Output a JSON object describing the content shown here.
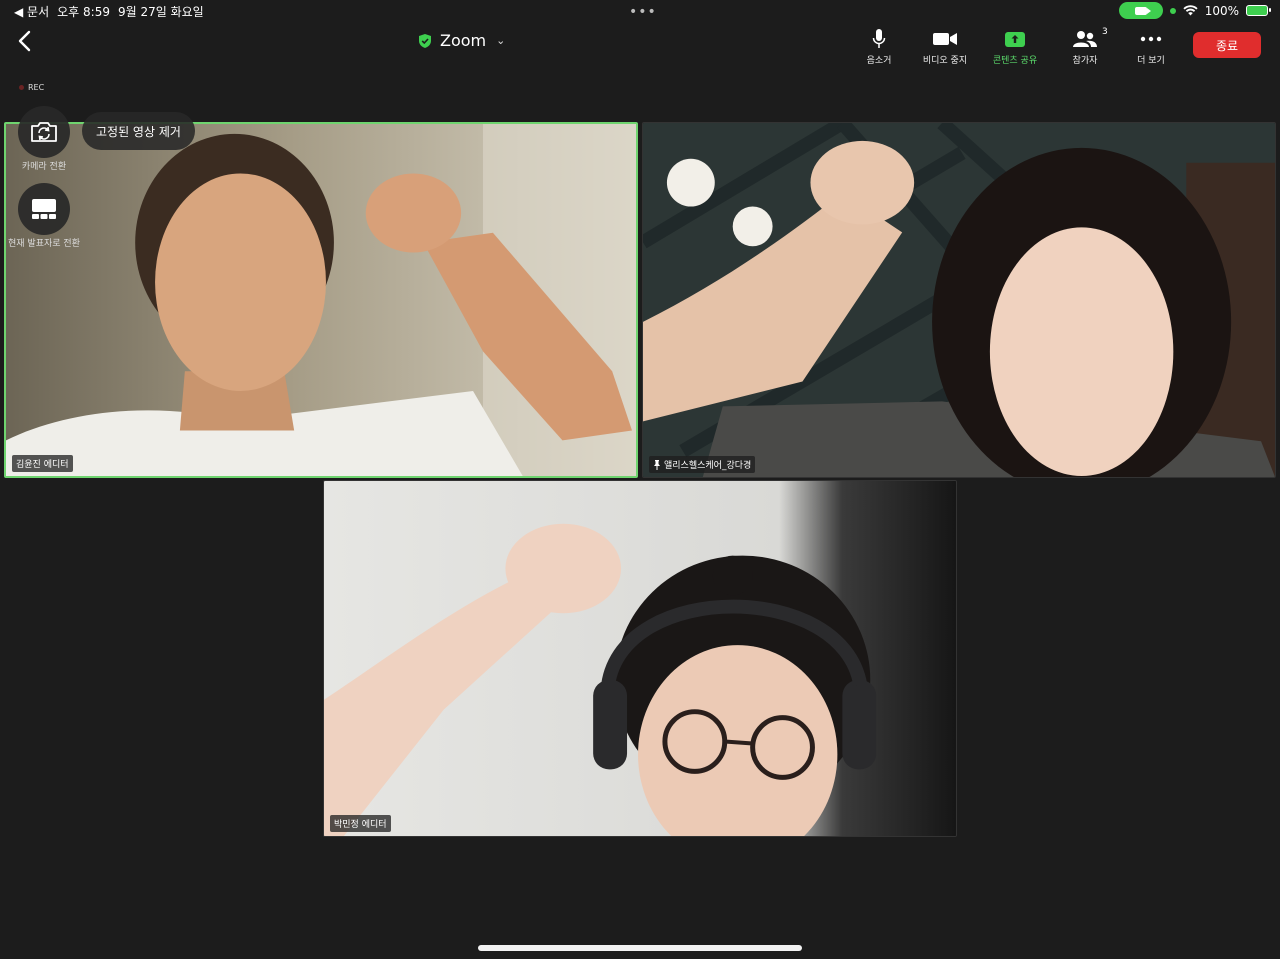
{
  "status_bar": {
    "back_app": "◀ 문서",
    "time": "오후 8:59",
    "date": "9월 27일 화요일",
    "battery": "100%"
  },
  "header": {
    "title": "Zoom",
    "title_caret": "⌄"
  },
  "toolbar": {
    "mute_label": "음소거",
    "stop_video_label": "비디오 중지",
    "share_label": "콘텐츠 공유",
    "participants_label": "참가자",
    "participants_count": "3",
    "more_label": "더 보기",
    "end_label": "종료"
  },
  "recording": {
    "label": "REC"
  },
  "floating": {
    "switch_camera_label": "카메라 전환",
    "switch_speaker_label": "현재 발표자로 전환",
    "unpin_label": "고정된 영상 제거"
  },
  "participants": [
    {
      "name": "김윤진 에디터"
    },
    {
      "name": "앨리스헬스케어_강다경"
    },
    {
      "name": "박민정 에디터"
    }
  ],
  "colors": {
    "accent_green": "#3ecf4f",
    "end_red": "#e02d2d",
    "active_border": "#6fd46f"
  }
}
